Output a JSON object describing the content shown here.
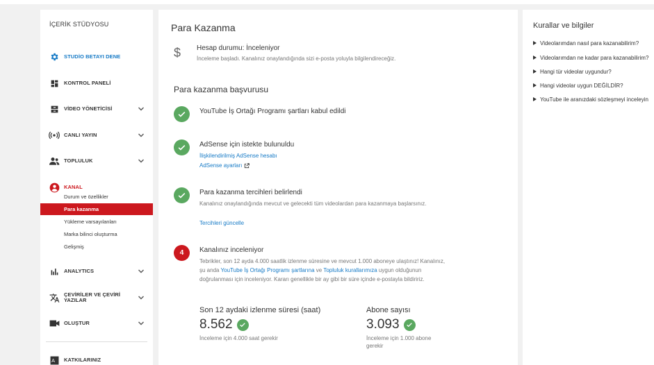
{
  "sidebar": {
    "title": "İÇERİK STÜDYOSU",
    "items": [
      {
        "label": "STUDİO BETAYI DENE",
        "icon": "gear-icon"
      },
      {
        "label": "KONTROL PANELİ",
        "icon": "dashboard-icon"
      },
      {
        "label": "VİDEO YÖNETİCİSİ",
        "icon": "video-manager-icon"
      },
      {
        "label": "CANLI YAYIN",
        "icon": "live-icon"
      },
      {
        "label": "TOPLULUK",
        "icon": "community-icon"
      },
      {
        "label": "KANAL",
        "icon": "channel-icon"
      },
      {
        "label": "ANALYTICS",
        "icon": "analytics-icon"
      },
      {
        "label": "ÇEVİRİLER VE ÇEVİRİ YAZILAR",
        "icon": "translate-icon"
      },
      {
        "label": "OLUŞTUR",
        "icon": "create-icon"
      },
      {
        "label": "KATKILARINIZ",
        "icon": "contributions-icon"
      }
    ],
    "channel_subitems": [
      "Durum ve özellikler",
      "Para kazanma",
      "Yükleme varsayılanları",
      "Marka bilinci oluşturma",
      "Gelişmiş"
    ]
  },
  "main": {
    "title": "Para Kazanma",
    "status_title": "Hesap durumu: İnceleniyor",
    "status_desc": "İnceleme başladı. Kanalınız onaylandığında sizi e-posta yoluyla bilgilendireceğiz.",
    "section_title": "Para kazanma başvurusu",
    "step1_title": "YouTube İş Ortağı Programı şartları kabul edildi",
    "step2_title": "AdSense için istekte bulunuldu",
    "step2_link1": "İlişkilendirilmiş AdSense hesabı",
    "step2_link2": "AdSense ayarları",
    "step3_title": "Para kazanma tercihleri belirlendi",
    "step3_desc": "Kanalınız onaylandığında mevcut ve gelecekti tüm videolardan para kazanmaya başlarsınız.",
    "step3_link": "Tercihleri güncelle",
    "step4_num": "4",
    "step4_title": "Kanalınız inceleniyor",
    "step4_desc_a": "Tebrikler, son 12 ayda 4.000 saatlik izlenme süresine ve mevcut 1.000 aboneye ulaştınız! Kanalınız, şu anda ",
    "step4_link_a": "YouTube İş Ortağı Programı şartlarına",
    "step4_desc_b": " ve ",
    "step4_link_b": "Topluluk kurallarımıza",
    "step4_desc_c": " uygun olduğunun doğrulanması için inceleniyor. Kararı genellikle bir ay gibi bir süre içinde e-postayla bildiririz.",
    "metric1_label": "Son 12 aydaki izlenme süresi (saat)",
    "metric1_value": "8.562",
    "metric1_note": "İnceleme için 4.000 saat gerekir",
    "metric2_label": "Abone sayısı",
    "metric2_value": "3.093",
    "metric2_note": "İnceleme için 1.000 abone gerekir"
  },
  "right": {
    "title": "Kurallar ve bilgiler",
    "rules": [
      "Videolarımdan nasıl para kazanabilirim?",
      "Videolarımdan ne kadar para kazanabilirim?",
      "Hangi tür videolar uygundur?",
      "Hangi videolar uygun DEĞİLDİR?",
      "YouTube ile aranızdaki sözleşmeyi inceleyin"
    ]
  },
  "colors": {
    "accent_blue": "#167ac6",
    "accent_red": "#cc181e",
    "check_green": "#5aa860"
  }
}
